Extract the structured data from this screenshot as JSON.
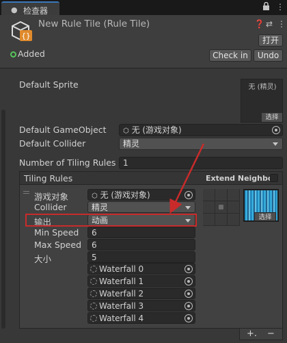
{
  "tab": {
    "title": "检查器",
    "icon": "info-icon"
  },
  "toolbar": {
    "lock_icon": "lock-icon",
    "menu_icon": "more-vert-icon"
  },
  "header": {
    "title": "New Rule Tile (Rule Tile)",
    "open_label": "打开",
    "checkin_label": "Check in",
    "undo_label": "Undo",
    "status_label": "Added"
  },
  "props": {
    "default_sprite_label": "Default Sprite",
    "sprite_none": "无 (精灵)",
    "sprite_select": "选择",
    "default_gameobject_label": "Default GameObject",
    "default_gameobject_value": "无 (游戏对象)",
    "default_collider_label": "Default Collider",
    "default_collider_value": "精灵",
    "tiling_rules_count_label": "Number of Tiling Rules",
    "tiling_rules_count_value": "1"
  },
  "rules": {
    "title": "Tiling Rules",
    "extend_neighbor": "Extend Neighbor",
    "gameobject_label": "游戏对象",
    "gameobject_value": "无 (游戏对象)",
    "collider_label": "Collider",
    "collider_value": "精灵",
    "output_label": "输出",
    "output_value": "动画",
    "min_speed_label": "Min Speed",
    "min_speed_value": "6",
    "max_speed_label": "Max Speed",
    "max_speed_value": "6",
    "size_label": "大小",
    "size_value": "5",
    "sprites": [
      "Waterfall 0",
      "Waterfall 1",
      "Waterfall 2",
      "Waterfall 3",
      "Waterfall 4"
    ],
    "preview_select": "选择",
    "add_label": "+.",
    "remove_label": "−"
  },
  "colors": {
    "accent": "#3a79bb",
    "added": "#56c65a",
    "annotation": "#c92b2b"
  }
}
